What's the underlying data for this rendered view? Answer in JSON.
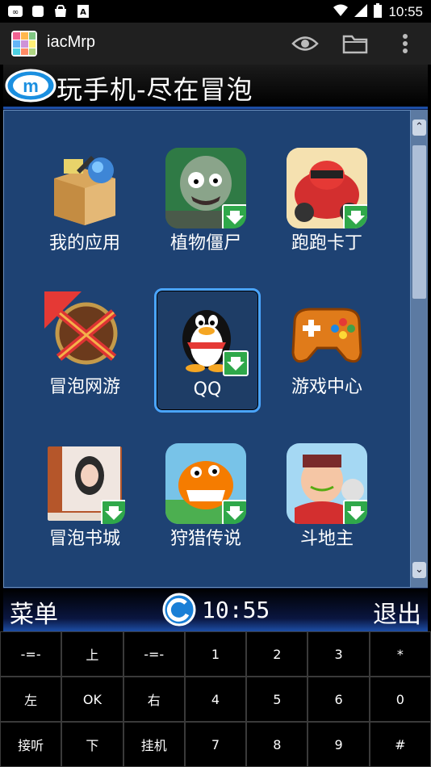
{
  "status_bar": {
    "time": "10:55"
  },
  "app_bar": {
    "title": "iacMrp"
  },
  "screen": {
    "header_title": "玩手机-尽在冒泡",
    "tiles": [
      {
        "label": "我的应用"
      },
      {
        "label": "植物僵尸"
      },
      {
        "label": "跑跑卡丁"
      },
      {
        "label": "冒泡网游"
      },
      {
        "label": "QQ"
      },
      {
        "label": "游戏中心"
      },
      {
        "label": "冒泡书城"
      },
      {
        "label": "狩猎传说"
      },
      {
        "label": "斗地主"
      }
    ],
    "footer": {
      "menu": "菜单",
      "clock": "10:55",
      "exit": "退出"
    }
  },
  "keypad": {
    "rows": [
      [
        "-=-",
        "上",
        "-=-",
        "1",
        "2",
        "3",
        "*"
      ],
      [
        "左",
        "OK",
        "右",
        "4",
        "5",
        "6",
        "0"
      ],
      [
        "接听",
        "下",
        "挂机",
        "7",
        "8",
        "9",
        "#"
      ]
    ]
  }
}
